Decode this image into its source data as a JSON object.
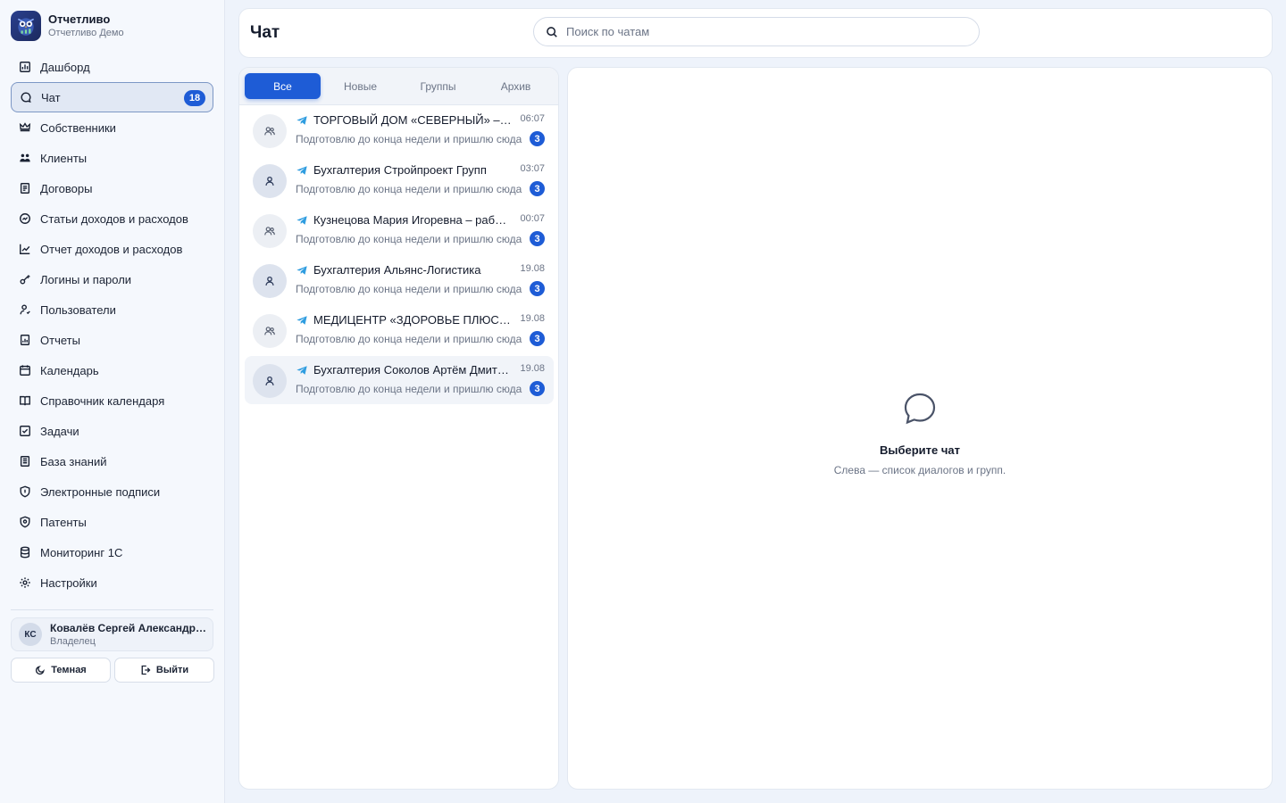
{
  "brand": {
    "title": "Отчетливо",
    "subtitle": "Отчетливо Демо"
  },
  "nav": [
    {
      "label": "Дашборд",
      "icon": "dashboard-icon"
    },
    {
      "label": "Чат",
      "icon": "chat-icon",
      "badge": "18",
      "active": true
    },
    {
      "label": "Собственники",
      "icon": "crown-icon"
    },
    {
      "label": "Клиенты",
      "icon": "clients-icon"
    },
    {
      "label": "Договоры",
      "icon": "contract-icon"
    },
    {
      "label": "Статьи доходов и расходов",
      "icon": "balance-icon"
    },
    {
      "label": "Отчет доходов и расходов",
      "icon": "line-chart-icon"
    },
    {
      "label": "Логины и пароли",
      "icon": "key-icon"
    },
    {
      "label": "Пользователи",
      "icon": "users-icon"
    },
    {
      "label": "Отчеты",
      "icon": "report-icon"
    },
    {
      "label": "Календарь",
      "icon": "calendar-icon"
    },
    {
      "label": "Справочник календаря",
      "icon": "book-icon"
    },
    {
      "label": "Задачи",
      "icon": "checkbox-icon"
    },
    {
      "label": "База знаний",
      "icon": "knowledge-icon"
    },
    {
      "label": "Электронные подписи",
      "icon": "shield-icon"
    },
    {
      "label": "Патенты",
      "icon": "patent-icon"
    },
    {
      "label": "Мониторинг 1С",
      "icon": "database-icon"
    },
    {
      "label": "Настройки",
      "icon": "gear-icon"
    }
  ],
  "user": {
    "initials": "КС",
    "name": "Ковалёв Сергей Александрович",
    "role": "Владелец"
  },
  "buttons": {
    "theme": "Темная",
    "logout": "Выйти"
  },
  "header": {
    "title": "Чат",
    "search_placeholder": "Поиск по чатам"
  },
  "tabs": [
    "Все",
    "Новые",
    "Группы",
    "Архив"
  ],
  "chats": [
    {
      "name": "ТОРГОВЫЙ ДОМ «СЕВЕРНЫЙ» – работа",
      "time": "06:07",
      "preview": "Подготовлю до конца недели и пришлю сюда",
      "unread": "3",
      "type": "group"
    },
    {
      "name": "Бухгалтерия Стройпроект Групп",
      "time": "03:07",
      "preview": "Подготовлю до конца недели и пришлю сюда",
      "unread": "3",
      "type": "person"
    },
    {
      "name": "Кузнецова Мария Игоревна – работа",
      "time": "00:07",
      "preview": "Подготовлю до конца недели и пришлю сюда",
      "unread": "3",
      "type": "group"
    },
    {
      "name": "Бухгалтерия Альянс-Логистика",
      "time": "19.08",
      "preview": "Подготовлю до конца недели и пришлю сюда",
      "unread": "3",
      "type": "person"
    },
    {
      "name": "МЕДИЦЕНТР «ЗДОРОВЬЕ ПЛЮС» – работа",
      "time": "19.08",
      "preview": "Подготовлю до конца недели и пришлю сюда",
      "unread": "3",
      "type": "group"
    },
    {
      "name": "Бухгалтерия Соколов Артём Дмитриевич",
      "time": "19.08",
      "preview": "Подготовлю до конца недели и пришлю сюда",
      "unread": "3",
      "type": "person",
      "selected": true
    }
  ],
  "empty": {
    "title": "Выберите чат",
    "subtitle": "Слева — список диалогов и групп."
  },
  "colors": {
    "accent": "#1e5cd6",
    "telegram": "#2f9de0",
    "sidebar_bg": "#f5f8fd"
  }
}
